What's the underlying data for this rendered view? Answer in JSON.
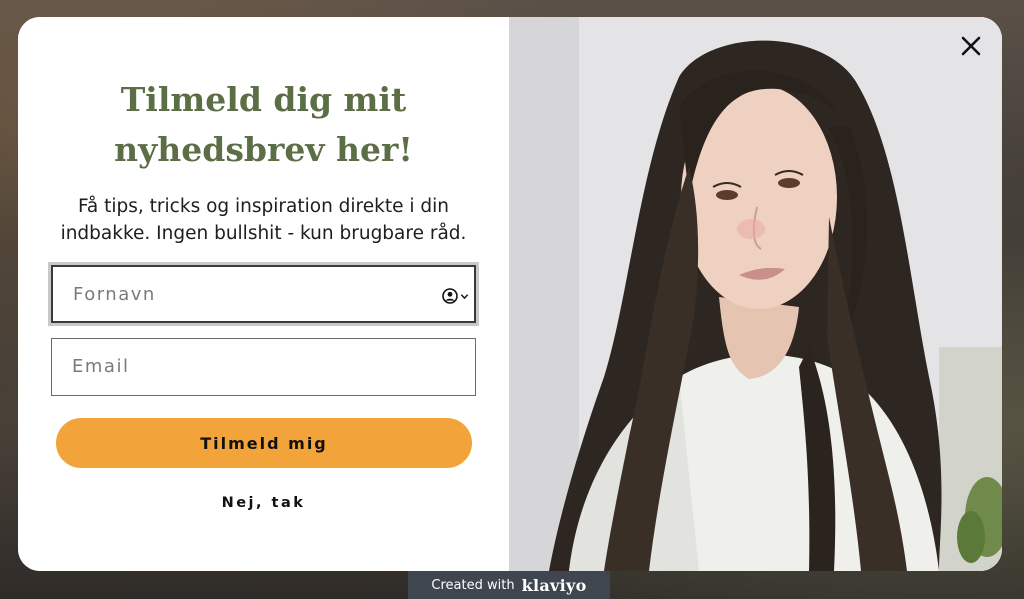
{
  "popup": {
    "heading_line1": "Tilmeld dig mit",
    "heading_line2": "nyhedsbrev her!",
    "subtitle_line1": "Få tips, tricks og inspiration direkte i din",
    "subtitle_line2": "indbakke. Ingen bullshit - kun brugbare råd.",
    "first_name_placeholder": "Fornavn",
    "email_placeholder": "Email",
    "submit_label": "Tilmeld mig",
    "decline_label": "Nej, tak"
  },
  "badge": {
    "prefix": "Created with",
    "brand": "klaviyo"
  },
  "colors": {
    "heading": "#5b6e45",
    "button": "#f2a43a",
    "badge_bg": "#3f4650"
  },
  "icons": {
    "close": "close-icon",
    "autofill": "contact-autofill-icon"
  }
}
